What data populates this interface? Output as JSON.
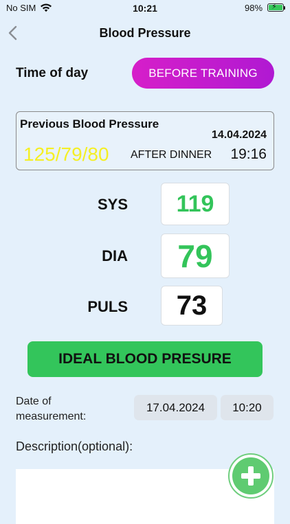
{
  "status_bar": {
    "carrier": "No SIM",
    "time": "10:21",
    "battery_percent": "98%",
    "battery_level": 0.98
  },
  "header": {
    "title": "Blood Pressure"
  },
  "time_of_day": {
    "label": "Time of day",
    "value": "BEFORE TRAINING"
  },
  "previous": {
    "title": "Previous Blood Pressure",
    "date": "14.04.2024",
    "value": "125/79/80",
    "time_of_day": "AFTER DINNER",
    "time": "19:16"
  },
  "vitals": {
    "sys_label": "SYS",
    "sys_value": "119",
    "dia_label": "DIA",
    "dia_value": "79",
    "puls_label": "PULS",
    "puls_value": "73"
  },
  "ideal_button": {
    "label": "IDEAL BLOOD PRESURE"
  },
  "measurement": {
    "label_line1": "Date of",
    "label_line2": "measurement:",
    "date": "17.04.2024",
    "time": "10:20"
  },
  "description": {
    "label": "Description(optional):",
    "value": ""
  },
  "colors": {
    "background": "#e4f0fb",
    "accent_magenta": "#c71ccd",
    "good_green": "#33c45a",
    "prev_value_yellow": "#f5ef24"
  },
  "icons": {
    "back": "chevron-left-icon",
    "wifi": "wifi-icon",
    "battery": "battery-charging-icon",
    "add": "plus-icon"
  }
}
